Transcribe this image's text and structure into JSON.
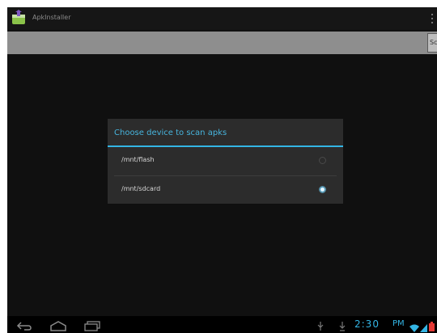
{
  "app": {
    "title": "ApkInstaller"
  },
  "filter_bar": {
    "button_label": "Sc"
  },
  "dialog": {
    "title": "Choose device to scan apks",
    "options": [
      {
        "label": "/mnt/flash",
        "selected": false
      },
      {
        "label": "/mnt/sdcard",
        "selected": true
      }
    ]
  },
  "status_bar": {
    "time": "2:30",
    "ampm": "PM"
  },
  "colors": {
    "accent": "#33b5e5",
    "background": "#101010",
    "dialog": "#2c2c2c"
  },
  "icons": {
    "app": "apk-installer-icon",
    "overflow": "overflow-menu-icon",
    "back": "back-icon",
    "home": "home-icon",
    "recents": "recent-apps-icon",
    "usb": "usb-icon",
    "download": "download-icon",
    "wifi": "wifi-icon",
    "signal": "signal-icon",
    "battery": "battery-icon"
  }
}
